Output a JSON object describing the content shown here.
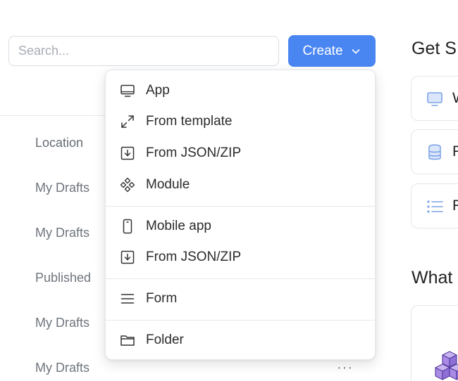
{
  "search": {
    "placeholder": "Search...",
    "value": ""
  },
  "create_button": {
    "label": "Create"
  },
  "table": {
    "column_header": "Location",
    "rows": [
      "My Drafts",
      "My Drafts",
      "Published",
      "My Drafts",
      "My Drafts"
    ]
  },
  "right": {
    "title_1": "Get S",
    "cards": [
      {
        "icon": "monitor-icon",
        "label": "W"
      },
      {
        "icon": "database-icon",
        "label": "F"
      },
      {
        "icon": "list-icon",
        "label": "F"
      }
    ],
    "title_2": "What"
  },
  "create_menu": {
    "items": [
      {
        "icon": "monitor-icon",
        "label": "App"
      },
      {
        "icon": "expand-arrows-icon",
        "label": "From template"
      },
      {
        "icon": "download-box-icon",
        "label": "From JSON/ZIP"
      },
      {
        "icon": "module-diamonds-icon",
        "label": "Module"
      },
      {
        "icon": "mobile-phone-icon",
        "label": "Mobile app"
      },
      {
        "icon": "download-box-icon",
        "label": "From JSON/ZIP"
      },
      {
        "icon": "hamburger-lines-icon",
        "label": "Form"
      },
      {
        "icon": "folder-icon",
        "label": "Folder"
      }
    ]
  },
  "row_actions": {
    "more": "···"
  },
  "colors": {
    "primary": "#4a86f2",
    "card_icon_blue": "#7aa2e6",
    "cube_purple": "#a98be6"
  }
}
